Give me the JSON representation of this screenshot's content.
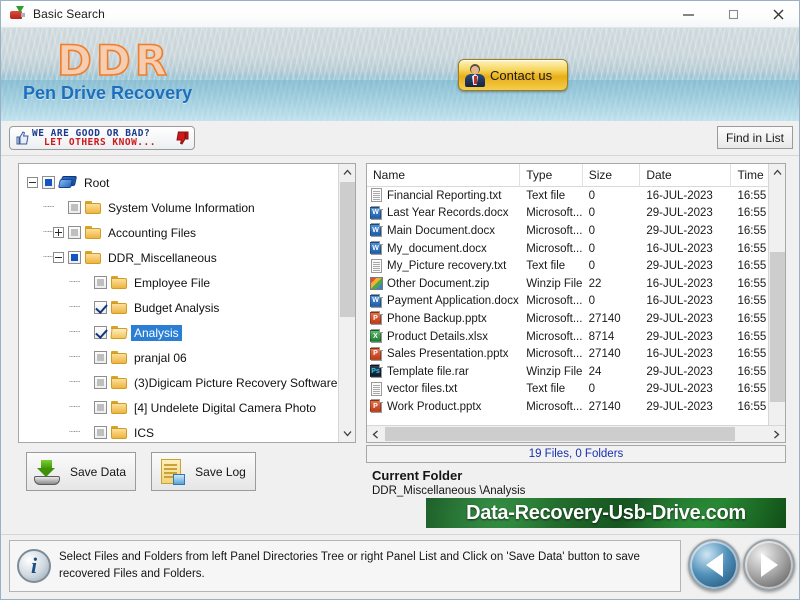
{
  "window": {
    "title": "Basic Search",
    "icon": "usb-drive-icon",
    "minimize": "–",
    "maximize": "□",
    "close": "✕"
  },
  "banner": {
    "logo": "DDR",
    "subtitle": "Pen Drive Recovery",
    "contact_label": "Contact us"
  },
  "toolbar": {
    "rate_line1": "WE  ARE  GOOD  OR  BAD?",
    "rate_line2": "LET OTHERS KNOW...",
    "find_label": "Find in List"
  },
  "tree": {
    "nodes": [
      {
        "label": "Root",
        "indent": 0,
        "expander": "minus",
        "check": "partial",
        "icon": "drive",
        "selected": false
      },
      {
        "label": "System Volume Information",
        "indent": 1,
        "expander": "none",
        "check": "grey",
        "icon": "folder",
        "selected": false
      },
      {
        "label": "Accounting Files",
        "indent": 1,
        "expander": "plus",
        "check": "grey",
        "icon": "folder",
        "selected": false
      },
      {
        "label": "DDR_Miscellaneous",
        "indent": 1,
        "expander": "minus",
        "check": "partial",
        "icon": "folder",
        "selected": false
      },
      {
        "label": "Employee File",
        "indent": 2,
        "expander": "none",
        "check": "grey",
        "icon": "folder",
        "selected": false
      },
      {
        "label": "Budget Analysis",
        "indent": 2,
        "expander": "none",
        "check": "checked",
        "icon": "folder",
        "selected": false
      },
      {
        "label": "Analysis",
        "indent": 2,
        "expander": "none",
        "check": "checked",
        "icon": "folder-open",
        "selected": true
      },
      {
        "label": "pranjal 06",
        "indent": 2,
        "expander": "none",
        "check": "grey",
        "icon": "folder",
        "selected": false
      },
      {
        "label": "(3)Digicam Picture Recovery Software",
        "indent": 2,
        "expander": "none",
        "check": "grey",
        "icon": "folder",
        "selected": false
      },
      {
        "label": "[4] Undelete Digital Camera Photo",
        "indent": 2,
        "expander": "none",
        "check": "grey",
        "icon": "folder",
        "selected": false
      },
      {
        "label": "ICS",
        "indent": 2,
        "expander": "none",
        "check": "grey",
        "icon": "folder",
        "selected": false
      }
    ]
  },
  "actions": {
    "save_data": "Save Data",
    "save_log": "Save Log"
  },
  "filelist": {
    "columns": [
      "Name",
      "Type",
      "Size",
      "Date",
      "Time"
    ],
    "rows": [
      {
        "name": "Financial Reporting.txt",
        "type": "Text file",
        "size": "0",
        "date": "16-JUL-2023",
        "time": "16:55",
        "icon": "txt"
      },
      {
        "name": "Last Year Records.docx",
        "type": "Microsoft...",
        "size": "0",
        "date": "29-JUL-2023",
        "time": "16:55",
        "icon": "word"
      },
      {
        "name": "Main Document.docx",
        "type": "Microsoft...",
        "size": "0",
        "date": "29-JUL-2023",
        "time": "16:55",
        "icon": "word"
      },
      {
        "name": "My_document.docx",
        "type": "Microsoft...",
        "size": "0",
        "date": "16-JUL-2023",
        "time": "16:55",
        "icon": "word"
      },
      {
        "name": "My_Picture recovery.txt",
        "type": "Text file",
        "size": "0",
        "date": "29-JUL-2023",
        "time": "16:55",
        "icon": "txt"
      },
      {
        "name": "Other Document.zip",
        "type": "Winzip File",
        "size": "22",
        "date": "16-JUL-2023",
        "time": "16:55",
        "icon": "zip"
      },
      {
        "name": "Payment Application.docx",
        "type": "Microsoft...",
        "size": "0",
        "date": "16-JUL-2023",
        "time": "16:55",
        "icon": "word"
      },
      {
        "name": "Phone Backup.pptx",
        "type": "Microsoft...",
        "size": "27140",
        "date": "29-JUL-2023",
        "time": "16:55",
        "icon": "ppt"
      },
      {
        "name": "Product Details.xlsx",
        "type": "Microsoft...",
        "size": "8714",
        "date": "29-JUL-2023",
        "time": "16:55",
        "icon": "xls"
      },
      {
        "name": "Sales Presentation.pptx",
        "type": "Microsoft...",
        "size": "27140",
        "date": "16-JUL-2023",
        "time": "16:55",
        "icon": "ppt"
      },
      {
        "name": "Template file.rar",
        "type": "Winzip File",
        "size": "24",
        "date": "29-JUL-2023",
        "time": "16:55",
        "icon": "ps"
      },
      {
        "name": "vector files.txt",
        "type": "Text file",
        "size": "0",
        "date": "29-JUL-2023",
        "time": "16:55",
        "icon": "txt"
      },
      {
        "name": "Work Product.pptx",
        "type": "Microsoft...",
        "size": "27140",
        "date": "29-JUL-2023",
        "time": "16:55",
        "icon": "ppt"
      }
    ]
  },
  "status": {
    "count": "19 Files, 0 Folders",
    "current_folder_title": "Current Folder",
    "current_folder_path": "DDR_Miscellaneous \\Analysis",
    "watermark": "Data-Recovery-Usb-Drive.com"
  },
  "footer": {
    "info": "Select Files and Folders from left Panel Directories Tree or right Panel List and Click on 'Save Data' button to save recovered Files and Folders.",
    "info_icon": "i"
  },
  "colors": {
    "accent_blue": "#1d6fbd",
    "logo_orange": "#f07d28",
    "selection_blue": "#2a7fd4",
    "status_blue": "#1a2fb0",
    "watermark_green": "#14591c"
  }
}
